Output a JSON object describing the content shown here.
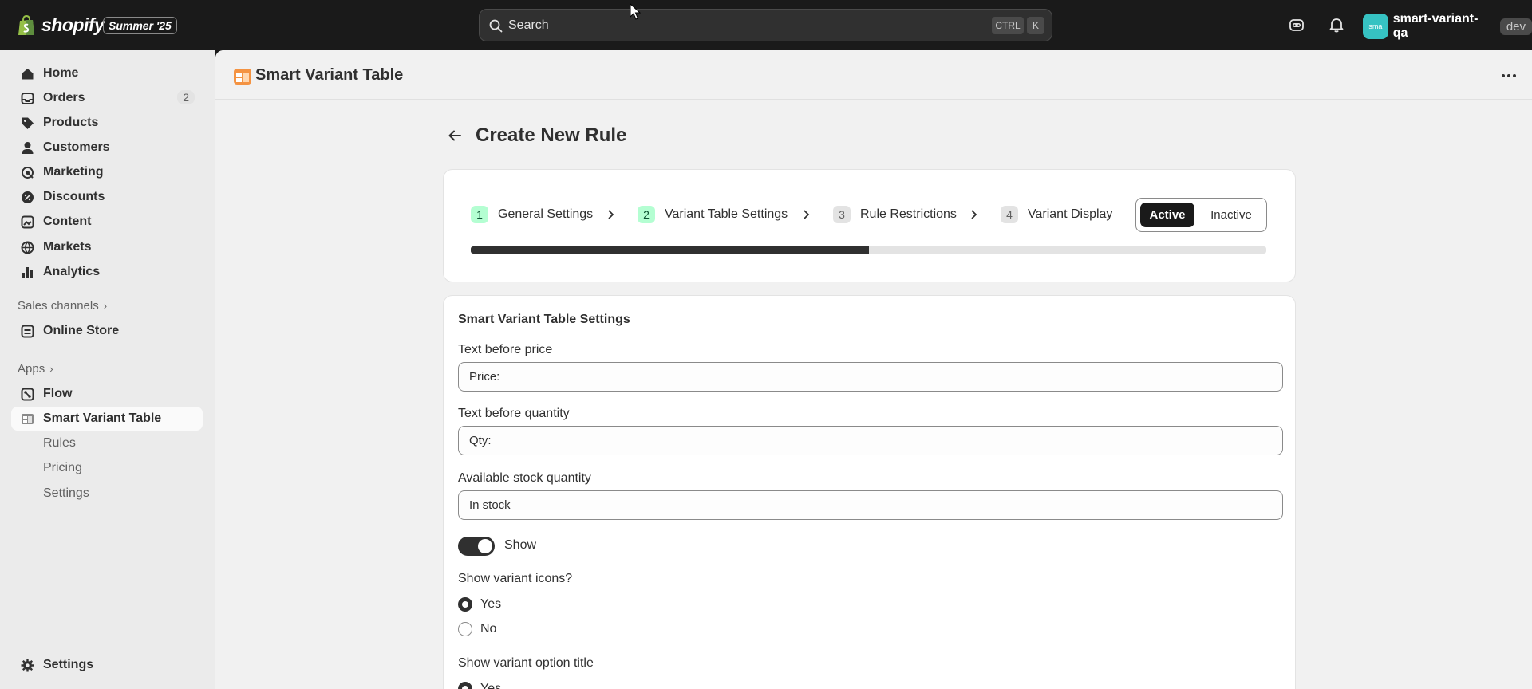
{
  "topbar": {
    "logo_text": "shopify",
    "edition_label": "Summer '25",
    "search_placeholder": "Search",
    "shortcut_ctrl": "CTRL",
    "shortcut_key": "K",
    "avatar_initials": "sma",
    "store_name": "smart-variant-qa",
    "store_badge": "dev"
  },
  "sidebar": {
    "items": [
      {
        "label": "Home",
        "icon": "home-icon"
      },
      {
        "label": "Orders",
        "icon": "inbox-icon",
        "badge": "2"
      },
      {
        "label": "Products",
        "icon": "tag-icon"
      },
      {
        "label": "Customers",
        "icon": "person-icon"
      },
      {
        "label": "Marketing",
        "icon": "target-icon"
      },
      {
        "label": "Discounts",
        "icon": "discount-icon"
      },
      {
        "label": "Content",
        "icon": "image-icon"
      },
      {
        "label": "Markets",
        "icon": "globe-icon"
      },
      {
        "label": "Analytics",
        "icon": "bar-chart-icon"
      }
    ],
    "sales_channels_label": "Sales channels",
    "online_store_label": "Online Store",
    "apps_label": "Apps",
    "flow_label": "Flow",
    "app_label": "Smart Variant Table",
    "app_subitems": [
      "Rules",
      "Pricing",
      "Settings"
    ],
    "settings_label": "Settings"
  },
  "app_header": {
    "title": "Smart Variant Table"
  },
  "page": {
    "title": "Create New Rule"
  },
  "steps": {
    "items": [
      {
        "number": "1",
        "label": "General Settings",
        "state": "done"
      },
      {
        "number": "2",
        "label": "Variant Table Settings",
        "state": "done"
      },
      {
        "number": "3",
        "label": "Rule Restrictions",
        "state": "todo"
      },
      {
        "number": "4",
        "label": "Variant Display",
        "state": "todo"
      }
    ],
    "status_options": [
      "Active",
      "Inactive"
    ],
    "selected_status": "Active",
    "progress_percent": 50
  },
  "settings": {
    "title": "Smart Variant Table Settings",
    "text_before_price_label": "Text before price",
    "text_before_price_value": "Price:",
    "text_before_quantity_label": "Text before quantity",
    "text_before_quantity_value": "Qty:",
    "available_stock_label": "Available stock quantity",
    "available_stock_value": "In stock",
    "show_toggle_label": "Show",
    "show_toggle_on": true,
    "variant_icons_question": "Show variant icons?",
    "variant_icons_options": [
      "Yes",
      "No"
    ],
    "variant_icons_selected": "Yes",
    "option_title_question": "Show variant option title",
    "option_title_first_option": "Yes"
  },
  "colors": {
    "topbar_bg": "#1a1a1a",
    "sidebar_bg": "#ebebeb",
    "main_bg": "#f1f1f1",
    "step_done": "#b4fed2",
    "progress_fill": "#303030",
    "app_icon_accent": "#f49342"
  }
}
